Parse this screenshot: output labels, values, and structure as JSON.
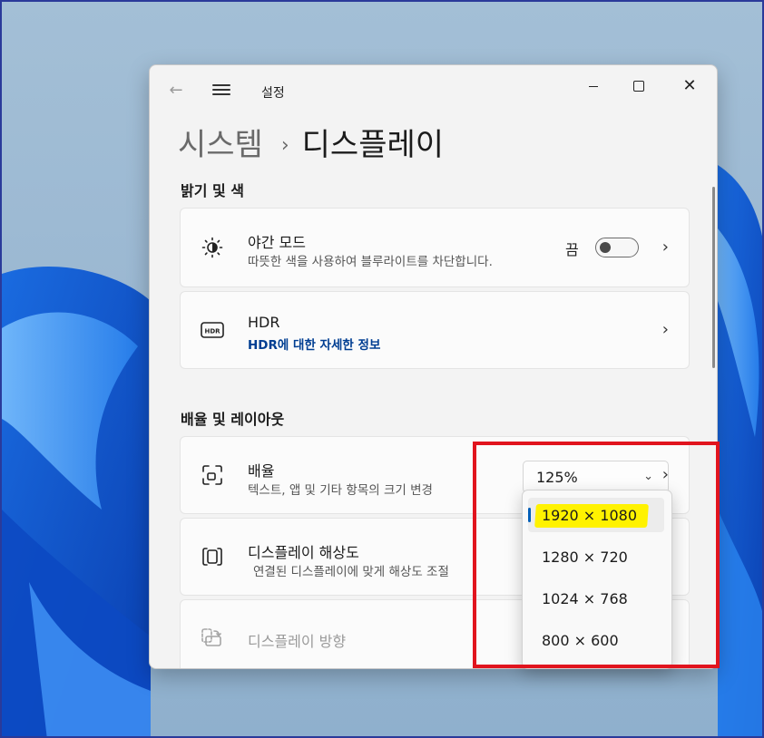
{
  "window": {
    "title": "설정",
    "controls": {
      "minimize": "minimize-icon",
      "maximize": "maximize-icon",
      "close": "close-icon"
    }
  },
  "breadcrumb": {
    "root": "시스템",
    "separator": "›",
    "current": "디스플레이"
  },
  "sections": {
    "brightness": "밝기 및 색",
    "scale_layout": "배율 및 레이아웃"
  },
  "night_light": {
    "title": "야간 모드",
    "desc": "따뜻한 색을 사용하여 블루라이트를 차단합니다.",
    "state_label": "끔",
    "on": false
  },
  "hdr": {
    "title": "HDR",
    "link": "HDR에 대한 자세한 정보"
  },
  "scale": {
    "title": "배율",
    "desc": "텍스트, 앱 및 기타 항목의 크기 변경",
    "value": "125%"
  },
  "resolution": {
    "title": "디스플레이 해상도",
    "desc": "연결된 디스플레이에 맞게 해상도 조절",
    "options": [
      "1920 × 1080",
      "1280 × 720",
      "1024 × 768",
      "800 × 600"
    ],
    "selected": "1920 × 1080"
  },
  "orientation": {
    "title": "디스플레이 방향"
  },
  "colors": {
    "accent": "#005fb8",
    "highlight": "#fff200",
    "annotation": "#e1141e",
    "link": "#003e92"
  }
}
